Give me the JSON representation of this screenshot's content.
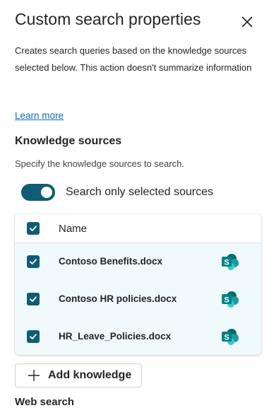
{
  "panel": {
    "title": "Custom search properties",
    "description": "Creates search queries based on the knowledge sources selected below. This action doesn't summarize information",
    "learn_more": "Learn more"
  },
  "knowledge": {
    "title": "Knowledge sources",
    "subtitle": "Specify the knowledge sources to search.",
    "toggle_label": "Search only selected sources",
    "toggle_on": true,
    "table": {
      "header": "Name",
      "rows": [
        {
          "name": "Contoso Benefits.docx",
          "checked": true,
          "icon": "sharepoint-icon"
        },
        {
          "name": "Contoso HR policies.docx",
          "checked": true,
          "icon": "sharepoint-icon"
        },
        {
          "name": "HR_Leave_Policies.docx",
          "checked": true,
          "icon": "sharepoint-icon"
        }
      ]
    },
    "add_button": "Add knowledge"
  },
  "next_section_partial": "Web search",
  "colors": {
    "accent": "#0f5c74",
    "link": "#0f6cbd",
    "row_selected_bg": "#f0f9fb",
    "sharepoint": "#038387"
  }
}
